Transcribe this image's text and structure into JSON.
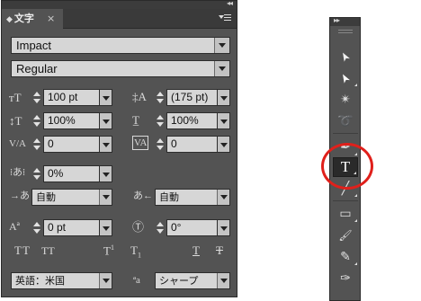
{
  "panel": {
    "tab_title": "文字",
    "close_glyph": "×",
    "collapse_glyph": "◂◂",
    "font_family": "Impact",
    "font_style": "Regular",
    "font_size": "100 pt",
    "leading": "(175 pt)",
    "vertical_scale": "100%",
    "horizontal_scale": "100%",
    "kerning": "0",
    "tracking": "0",
    "tsume": "0%",
    "aki_left": "自動",
    "aki_right": "自動",
    "baseline_shift": "0 pt",
    "rotation": "0°",
    "language": "英語：米国",
    "antialias": "シャープ",
    "style_buttons": [
      "TT",
      "TT",
      "T",
      "T",
      "T",
      "T"
    ]
  },
  "tools": {
    "collapse_glyph": "▸▸",
    "items": [
      {
        "name": "selection-tool",
        "glyph": "➤"
      },
      {
        "name": "direct-selection-tool",
        "glyph": "➤"
      },
      {
        "name": "magic-wand-tool",
        "glyph": "✴"
      },
      {
        "name": "lasso-tool",
        "glyph": "➰"
      },
      {
        "name": "pen-tool",
        "glyph": "✒"
      },
      {
        "name": "type-tool",
        "glyph": "T"
      },
      {
        "name": "line-tool",
        "glyph": "╱"
      },
      {
        "name": "rectangle-tool",
        "glyph": "▭"
      },
      {
        "name": "paintbrush-tool",
        "glyph": "🖌"
      },
      {
        "name": "pencil-tool",
        "glyph": "✎"
      },
      {
        "name": "blob-brush-tool",
        "glyph": "✑"
      }
    ]
  },
  "accent": {
    "highlight": "#e0201b",
    "panel_bg": "#535353"
  }
}
